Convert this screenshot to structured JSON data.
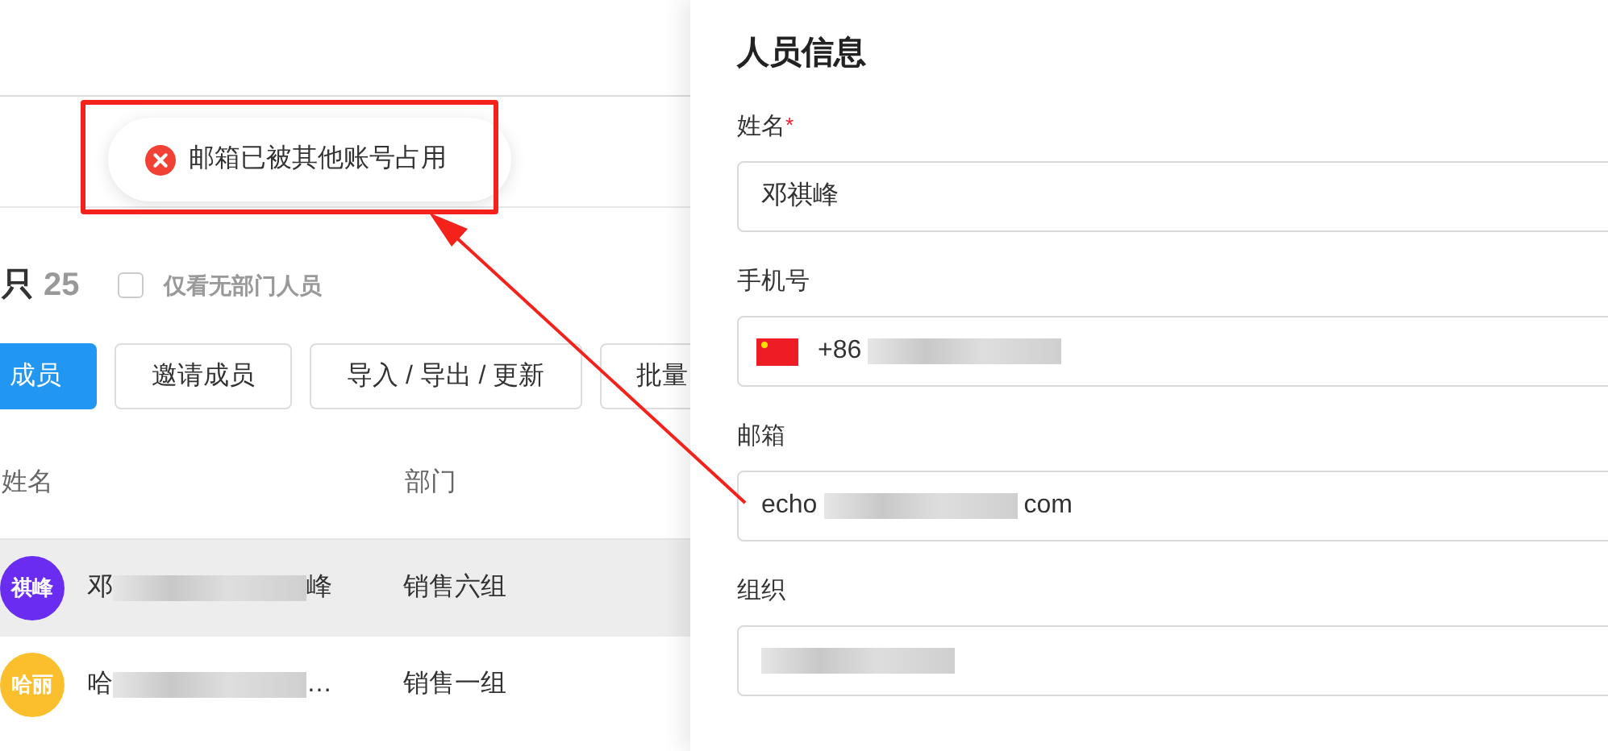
{
  "toast": {
    "kind": "error",
    "message": "邮箱已被其他账号占用"
  },
  "members": {
    "title": "只",
    "count": "25",
    "filter": {
      "label": "仅看无部门人员",
      "checked": false
    },
    "buttons": [
      {
        "label": "成员",
        "kind": "primary"
      },
      {
        "label": "邀请成员",
        "kind": "default"
      },
      {
        "label": "导入 / 导出 / 更新",
        "kind": "default"
      },
      {
        "label": "批量",
        "kind": "default"
      }
    ],
    "columns": [
      "姓名",
      "部门"
    ],
    "rows": [
      {
        "avatar": "祺峰",
        "color": "#6a2cf0",
        "name": [
          {
            "kind": "text",
            "text": "邓"
          },
          {
            "kind": "mask"
          },
          {
            "kind": "text",
            "text": "峰"
          }
        ],
        "department": "销售六组",
        "selected": true
      },
      {
        "avatar": "哈丽",
        "color": "#fbbf2d",
        "name": [
          {
            "kind": "text",
            "text": "哈"
          },
          {
            "kind": "mask"
          },
          {
            "kind": "text",
            "text": "…"
          }
        ],
        "department": "销售一组",
        "selected": false
      }
    ]
  },
  "panel": {
    "title": "人员信息",
    "fields": [
      {
        "label": "姓名",
        "required_mark": "*",
        "kind": "text",
        "value": [
          {
            "kind": "text",
            "text": "邓祺峰"
          }
        ]
      },
      {
        "label": "手机号",
        "kind": "phone",
        "value": [
          {
            "kind": "text",
            "text": "+86"
          },
          {
            "kind": "mask"
          }
        ]
      },
      {
        "label": "邮箱",
        "kind": "text",
        "value": [
          {
            "kind": "text",
            "text": "echo"
          },
          {
            "kind": "mask"
          },
          {
            "kind": "text",
            "text": "com"
          }
        ]
      },
      {
        "label": "组织",
        "kind": "text",
        "value": [
          {
            "kind": "mask"
          }
        ]
      }
    ]
  }
}
